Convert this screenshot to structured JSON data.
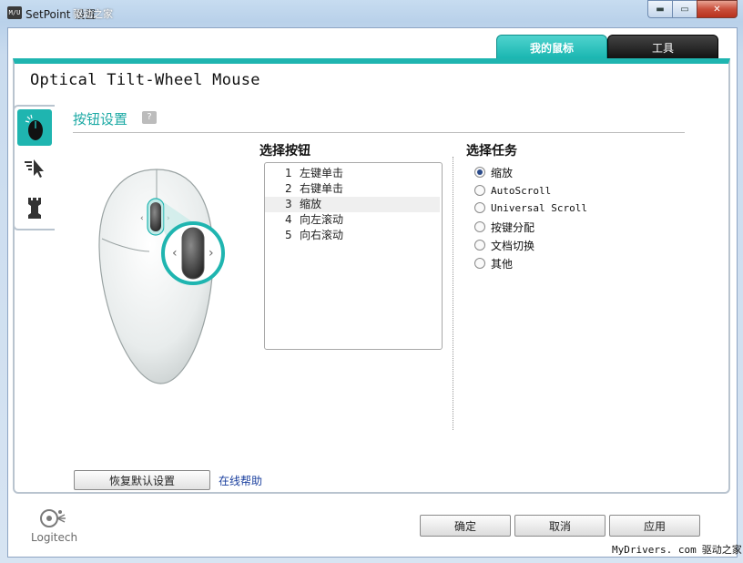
{
  "window": {
    "app_icon_text": "M/U",
    "title": "SetPoint 设置",
    "watermark_overlay": "驱动之家",
    "controls": {
      "minimize": "▬",
      "maximize": "▭",
      "close": "✕"
    }
  },
  "tabs": [
    {
      "label": "我的鼠标",
      "active": true
    },
    {
      "label": "工具",
      "active": false
    }
  ],
  "device_name": "Optical Tilt-Wheel Mouse",
  "side_tabs": [
    {
      "icon": "mouse-buttons-icon",
      "active": true
    },
    {
      "icon": "pointer-icon",
      "active": false
    },
    {
      "icon": "game-icon",
      "active": false
    }
  ],
  "section": {
    "title": "按钮设置",
    "help": "?"
  },
  "select_button": {
    "title": "选择按钮",
    "items": [
      {
        "num": "1",
        "label": "左键单击"
      },
      {
        "num": "2",
        "label": "右键单击"
      },
      {
        "num": "3",
        "label": "缩放",
        "selected": true
      },
      {
        "num": "4",
        "label": "向左滚动"
      },
      {
        "num": "5",
        "label": "向右滚动"
      }
    ]
  },
  "select_task": {
    "title": "选择任务",
    "options": [
      {
        "label": "缩放",
        "checked": true
      },
      {
        "label": "AutoScroll",
        "checked": false
      },
      {
        "label": "Universal Scroll",
        "checked": false
      },
      {
        "label": "按键分配",
        "checked": false
      },
      {
        "label": "文档切换",
        "checked": false
      },
      {
        "label": "其他",
        "checked": false
      }
    ]
  },
  "restore_button": "恢复默认设置",
  "online_help": "在线帮助",
  "logo_text": "Logitech",
  "buttons": {
    "ok": "确定",
    "cancel": "取消",
    "apply": "应用"
  },
  "bottom_watermark": {
    "en": "MyDrivers. com",
    "cn": "驱动之家"
  },
  "colors": {
    "accent": "#1fb5b0",
    "link": "#1a3f9e",
    "tab_dark": "#111111"
  }
}
